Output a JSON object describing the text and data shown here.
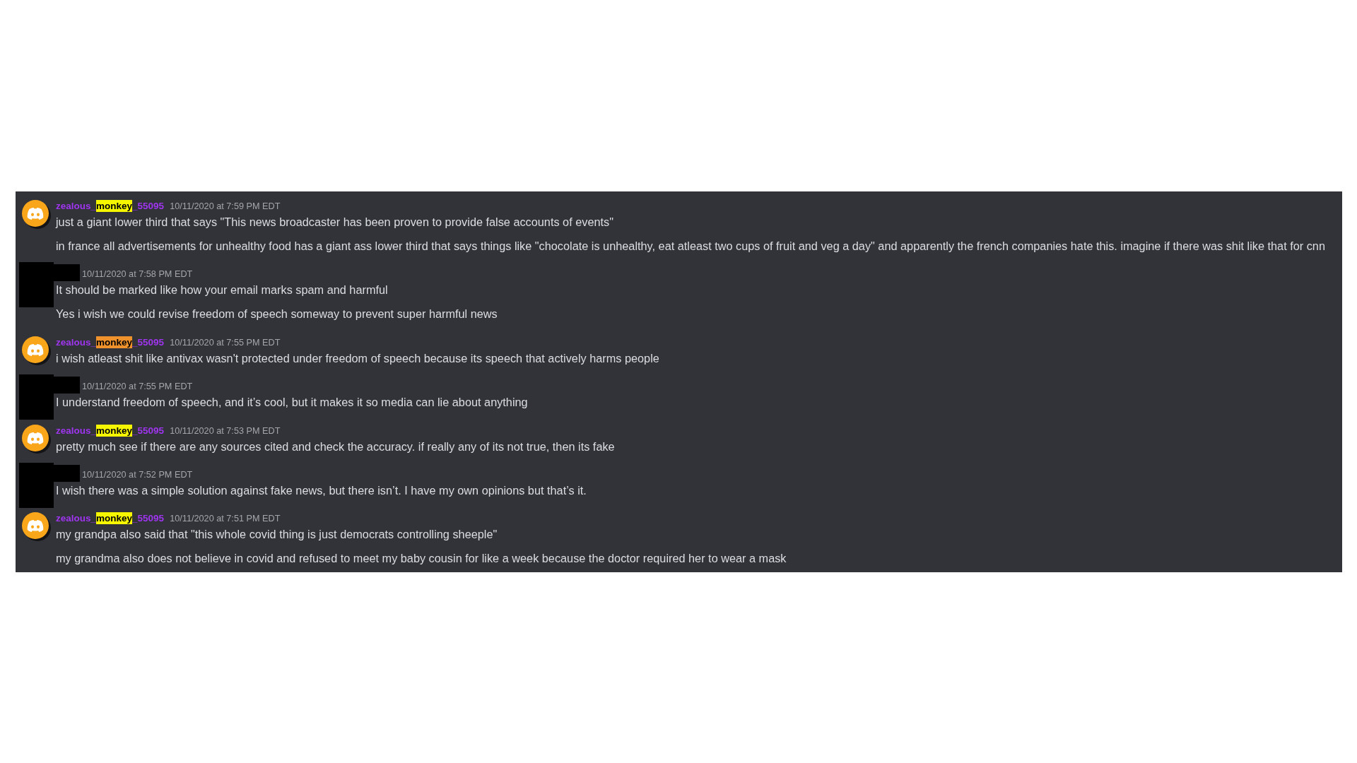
{
  "messages": [
    {
      "kind": "user",
      "author": {
        "name_start": "zealous_",
        "search_match": "monkey",
        "name_end": "_55095",
        "match_selected": false
      },
      "timestamp": "10/11/2020 at 7:59 PM EDT",
      "lines": [
        "just a giant lower third that says \"This news broadcaster has been proven to provide false accounts of events\"",
        "in france all advertisements for unhealthy food has a giant ass lower third that says things like \"chocolate is unhealthy, eat atleast two cups of fruit and veg a day\" and apparently the french companies hate this. imagine if there was shit like that for cnn"
      ]
    },
    {
      "kind": "redacted",
      "timestamp": "10/11/2020 at 7:58 PM EDT",
      "lines": [
        "It should be marked like how your email marks spam and harmful",
        "Yes i wish we could revise freedom of speech someway to prevent super harmful news"
      ]
    },
    {
      "kind": "user",
      "author": {
        "name_start": "zealous_",
        "search_match": "monkey",
        "name_end": "_55095",
        "match_selected": true
      },
      "timestamp": "10/11/2020 at 7:55 PM EDT",
      "lines": [
        "i wish atleast shit like antivax wasn't protected under freedom of speech because its speech that actively harms people"
      ]
    },
    {
      "kind": "redacted",
      "timestamp": "10/11/2020 at 7:55 PM EDT",
      "lines": [
        "I understand freedom of speech, and it’s cool, but it makes it so media can lie about anything"
      ]
    },
    {
      "kind": "user",
      "author": {
        "name_start": "zealous_",
        "search_match": "monkey",
        "name_end": "_55095",
        "match_selected": false
      },
      "timestamp": "10/11/2020 at 7:53 PM EDT",
      "lines": [
        "pretty much see if there are any sources cited and check the accuracy. if really any of its not true, then its fake"
      ]
    },
    {
      "kind": "redacted",
      "timestamp": "10/11/2020 at 7:52 PM EDT",
      "lines": [
        "I wish there was a simple solution against fake news, but there isn’t. I have my own opinions but that’s it."
      ]
    },
    {
      "kind": "user",
      "author": {
        "name_start": "zealous_",
        "search_match": "monkey",
        "name_end": "_55095",
        "match_selected": false
      },
      "timestamp": "10/11/2020 at 7:51 PM EDT",
      "lines": [
        "my grandpa also said that \"this whole covid thing is just democrats controlling sheeple\"",
        "my grandma also does not believe in covid and refused to meet my baby cousin for like a week because the doctor required her to wear a mask"
      ]
    }
  ]
}
